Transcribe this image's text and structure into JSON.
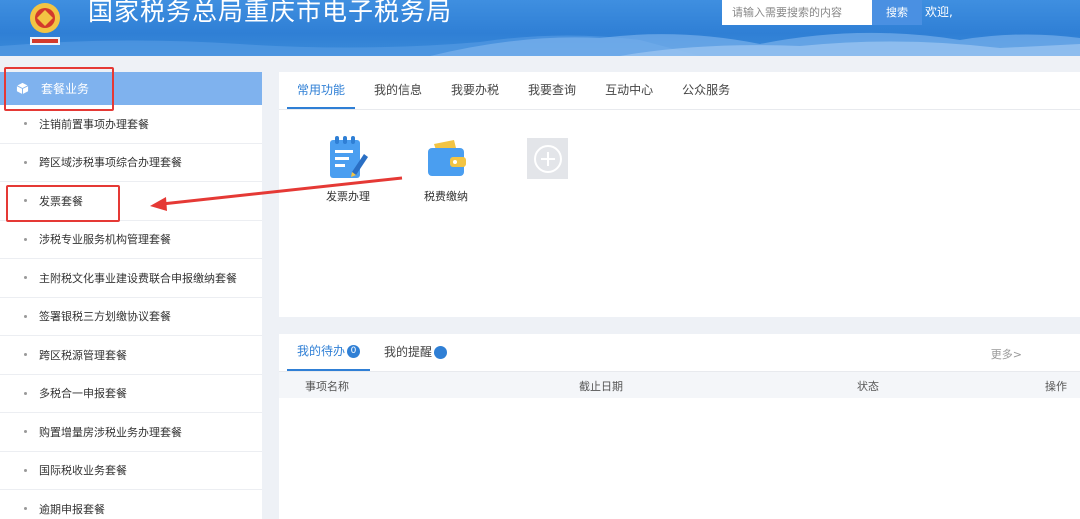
{
  "header": {
    "site_title": "国家税务总局重庆市电子税务局",
    "search_placeholder": "请输入需要搜索的内容",
    "search_button": "搜索",
    "welcome": "欢迎,"
  },
  "sidebar": {
    "heading": "套餐业务",
    "items": [
      {
        "label": "注销前置事项办理套餐"
      },
      {
        "label": "跨区域涉税事项综合办理套餐"
      },
      {
        "label": "发票套餐"
      },
      {
        "label": "涉税专业服务机构管理套餐"
      },
      {
        "label": "主附税文化事业建设费联合申报缴纳套餐"
      },
      {
        "label": "签署银税三方划缴协议套餐"
      },
      {
        "label": "跨区税源管理套餐"
      },
      {
        "label": "多税合一申报套餐"
      },
      {
        "label": "购置增量房涉税业务办理套餐"
      },
      {
        "label": "国际税收业务套餐"
      },
      {
        "label": "逾期申报套餐"
      }
    ]
  },
  "main": {
    "tabs": [
      {
        "label": "常用功能",
        "active": true
      },
      {
        "label": "我的信息"
      },
      {
        "label": "我要办税"
      },
      {
        "label": "我要查询"
      },
      {
        "label": "互动中心"
      },
      {
        "label": "公众服务"
      }
    ],
    "functions": [
      {
        "label": "发票办理",
        "icon": "invoice-edit-icon"
      },
      {
        "label": "税费缴纳",
        "icon": "wallet-icon"
      }
    ],
    "add_icon": "plus-circle-icon"
  },
  "todo": {
    "tabs": [
      {
        "label": "我的待办",
        "badge": "0",
        "active": true
      },
      {
        "label": "我的提醒",
        "badge": ""
      }
    ],
    "more": "更多>",
    "columns": [
      "事项名称",
      "截止日期",
      "状态",
      "操作"
    ]
  },
  "colors": {
    "accent": "#2f7fd5",
    "annotation": "#e53935",
    "sidebar_head": "#7fb2ee"
  }
}
